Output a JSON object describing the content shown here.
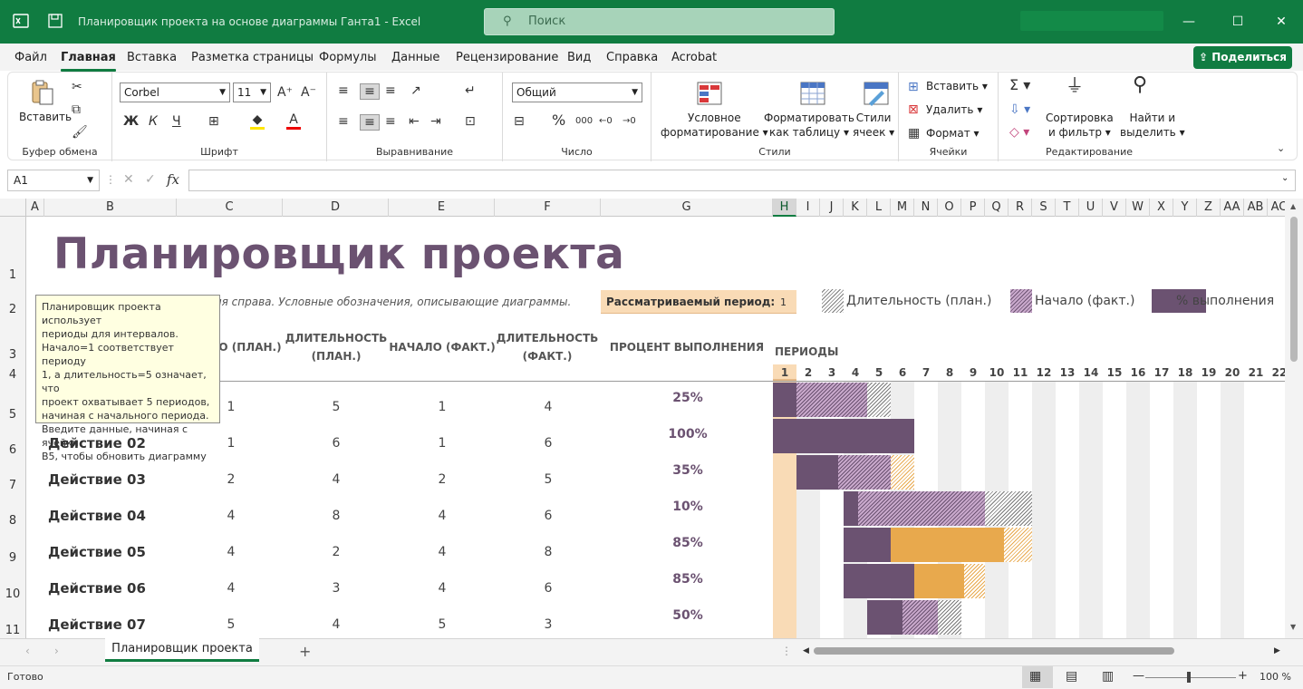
{
  "window": {
    "title": "Планировщик проекта на основе диаграммы Ганта1  -  Excel",
    "search_placeholder": "Поиск"
  },
  "menu": {
    "tabs": [
      "Файл",
      "Главная",
      "Вставка",
      "Разметка страницы",
      "Формулы",
      "Данные",
      "Рецензирование",
      "Вид",
      "Справка",
      "Acrobat"
    ],
    "active_tab": "Главная",
    "share_label": "Поделиться"
  },
  "ribbon": {
    "clipboard": {
      "paste": "Вставить",
      "group": "Буфер обмена"
    },
    "font": {
      "name": "Corbel",
      "size": "11",
      "bold": "Ж",
      "italic": "К",
      "underline": "Ч",
      "group": "Шрифт"
    },
    "alignment": {
      "group": "Выравнивание"
    },
    "number": {
      "format": "Общий",
      "group": "Число"
    },
    "styles": {
      "conditional": [
        "Условное",
        "форматирование"
      ],
      "as_table": [
        "Форматировать",
        "как таблицу"
      ],
      "cell_styles": [
        "Стили",
        "ячеек"
      ],
      "group": "Стили"
    },
    "cells": {
      "insert": "Вставить",
      "delete": "Удалить",
      "format": "Формат",
      "group": "Ячейки"
    },
    "editing": {
      "sort": [
        "Сортировка",
        "и фильтр"
      ],
      "find": [
        "Найти и",
        "выделить"
      ],
      "group": "Редактирование"
    }
  },
  "formula_bar": {
    "name_box": "A1",
    "fx": "fx",
    "value": ""
  },
  "columns": [
    "A",
    "B",
    "C",
    "D",
    "E",
    "F",
    "G",
    "H",
    "I",
    "J",
    "K",
    "L",
    "M",
    "N",
    "O",
    "P",
    "Q",
    "R",
    "S",
    "T",
    "U",
    "V",
    "W",
    "X",
    "Y",
    "Z",
    "AA",
    "AB",
    "AC"
  ],
  "rows": [
    "1",
    "2",
    "3",
    "4",
    "5",
    "6",
    "7",
    "8",
    "9",
    "10",
    "11"
  ],
  "sheet": {
    "title": "Планировщик проекта",
    "hint": "ния справа.  Условные обозначения, описывающие диаграммы.",
    "period_label": "Рассматриваемый период:",
    "period_value": "1",
    "legend": {
      "plan": "Длительность (план.)",
      "actual_start": "Начало (факт.)",
      "percent": "% выполнения"
    },
    "headers": {
      "start_plan": "ЛО (ПЛАН.)",
      "duration_plan": [
        "ДЛИТЕЛЬНОСТЬ",
        "(ПЛАН.)"
      ],
      "start_actual": "НАЧАЛО (ФАКТ.)",
      "duration_actual": [
        "ДЛИТЕЛЬНОСТЬ",
        "(ФАКТ.)"
      ],
      "percent": "ПРОЦЕНТ ВЫПОЛНЕНИЯ",
      "periods": "ПЕРИОДЫ"
    },
    "period_numbers": [
      "1",
      "2",
      "3",
      "4",
      "5",
      "6",
      "7",
      "8",
      "9",
      "10",
      "11",
      "12",
      "13",
      "14",
      "15",
      "16",
      "17",
      "18",
      "19",
      "20",
      "21",
      "22"
    ],
    "activities": [
      {
        "name": "",
        "start_plan": "1",
        "dur_plan": "5",
        "start_act": "1",
        "dur_act": "4",
        "percent": "25%",
        "pct_value": 25
      },
      {
        "name": "Действие 02",
        "start_plan": "1",
        "dur_plan": "6",
        "start_act": "1",
        "dur_act": "6",
        "percent": "100%",
        "pct_value": 100
      },
      {
        "name": "Действие 03",
        "start_plan": "2",
        "dur_plan": "4",
        "start_act": "2",
        "dur_act": "5",
        "percent": "35%",
        "pct_value": 35
      },
      {
        "name": "Действие 04",
        "start_plan": "4",
        "dur_plan": "8",
        "start_act": "4",
        "dur_act": "6",
        "percent": "10%",
        "pct_value": 10
      },
      {
        "name": "Действие 05",
        "start_plan": "4",
        "dur_plan": "2",
        "start_act": "4",
        "dur_act": "8",
        "percent": "85%",
        "pct_value": 85
      },
      {
        "name": "Действие 06",
        "start_plan": "4",
        "dur_plan": "3",
        "start_act": "4",
        "dur_act": "6",
        "percent": "85%",
        "pct_value": 85
      },
      {
        "name": "Действие 07",
        "start_plan": "5",
        "dur_plan": "4",
        "start_act": "5",
        "dur_act": "3",
        "percent": "50%",
        "pct_value": 50
      }
    ]
  },
  "tooltip": [
    "Планировщик проекта использует",
    "периоды для интервалов.",
    "Начало=1 соответствует периоду",
    "1, а длительность=5 означает, что",
    "проект охватывает 5 периодов,",
    "начиная с начального периода.",
    "Введите данные, начиная с ячейки",
    "B5, чтобы обновить диаграмму"
  ],
  "sheet_tab": "Планировщик проекта",
  "status": {
    "ready": "Готово",
    "zoom": "100 %"
  },
  "colors": {
    "brand": "#107c41",
    "plum": "#6b5271",
    "orange": "#e8a94d",
    "period_highlight": "#f9dbb6"
  }
}
